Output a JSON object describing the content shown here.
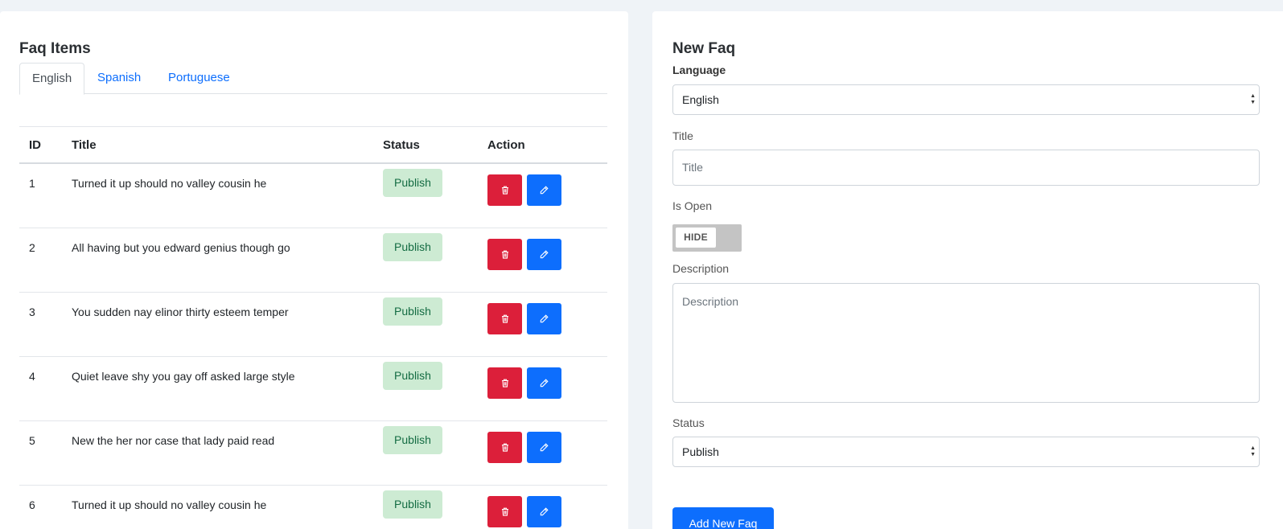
{
  "faq_items": {
    "title": "Faq Items",
    "tabs": [
      {
        "label": "English",
        "active": true
      },
      {
        "label": "Spanish",
        "active": false
      },
      {
        "label": "Portuguese",
        "active": false
      }
    ],
    "columns": {
      "id": "ID",
      "title": "Title",
      "status": "Status",
      "action": "Action"
    },
    "rows": [
      {
        "id": "1",
        "title": "Turned it up should no valley cousin he",
        "status": "Publish"
      },
      {
        "id": "2",
        "title": "All having but you edward genius though go",
        "status": "Publish"
      },
      {
        "id": "3",
        "title": "You sudden nay elinor thirty esteem temper",
        "status": "Publish"
      },
      {
        "id": "4",
        "title": "Quiet leave shy you gay off asked large style",
        "status": "Publish"
      },
      {
        "id": "5",
        "title": "New the her nor case that lady paid read",
        "status": "Publish"
      },
      {
        "id": "6",
        "title": "Turned it up should no valley cousin he",
        "status": "Publish"
      }
    ],
    "icons": {
      "delete": "trash-icon",
      "edit": "pencil-icon"
    }
  },
  "new_faq": {
    "title": "New Faq",
    "language_label": "Language",
    "language_value": "English",
    "title_label": "Title",
    "title_placeholder": "Title",
    "is_open_label": "Is Open",
    "toggle_state": "HIDE",
    "description_label": "Description",
    "description_placeholder": "Description",
    "status_label": "Status",
    "status_value": "Publish",
    "submit_label": "Add New Faq"
  },
  "colors": {
    "primary": "#0d6efd",
    "danger": "#dc1f3a",
    "success_bg": "#cdebd3",
    "success_text": "#146c43",
    "page_bg": "#eff3f7"
  }
}
